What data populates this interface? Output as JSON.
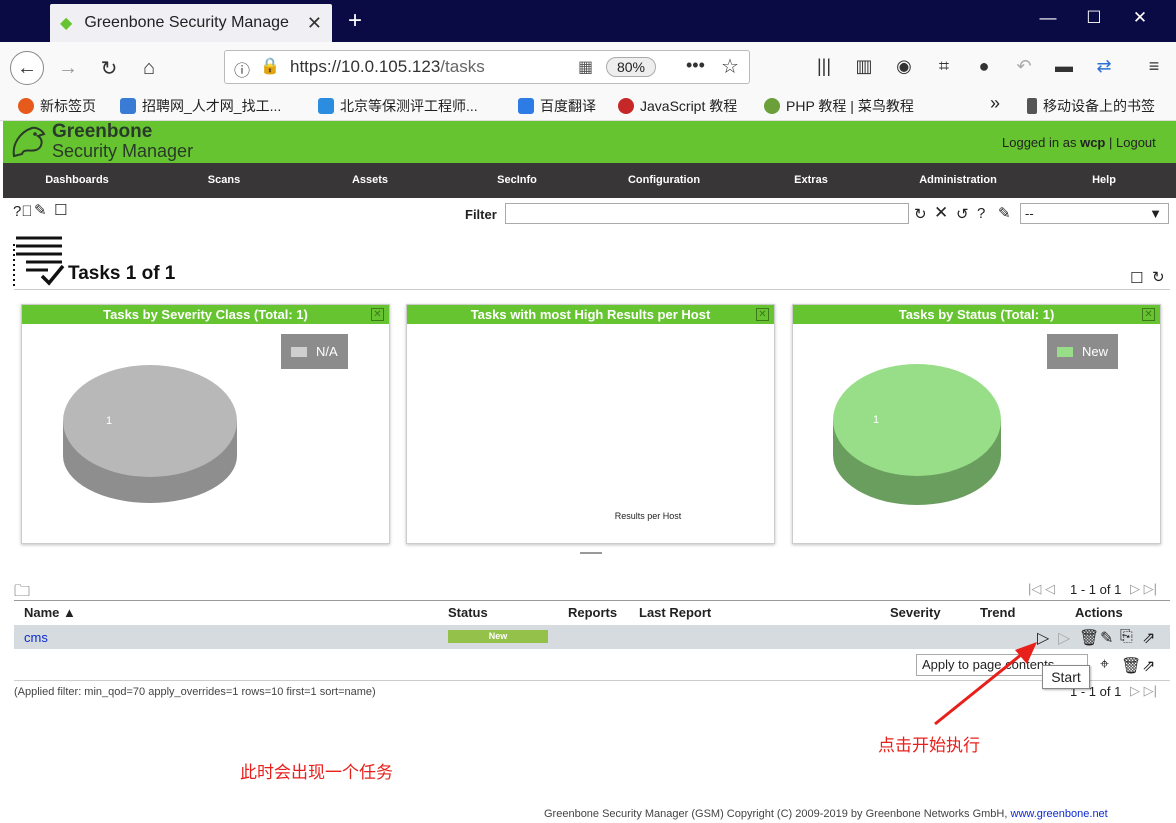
{
  "browser": {
    "tab_title": "Greenbone Security Manager",
    "tab_close": "✕",
    "new_tab": "+",
    "url_host": "https://10.0.105.123",
    "url_path": "/tasks",
    "zoom": "80%",
    "bookmarks": [
      {
        "label": "新标签页",
        "color": "#e65a1c"
      },
      {
        "label": "招聘网_人才网_找工...",
        "color": "#3a7bd5"
      },
      {
        "label": "北京等保测评工程师...",
        "color": "#2a8de0"
      },
      {
        "label": "百度翻译",
        "color": "#2d7be5"
      },
      {
        "label": "JavaScript 教程",
        "color": "#c62828"
      },
      {
        "label": "PHP 教程 | 菜鸟教程",
        "color": "#6a9f3a"
      }
    ],
    "bookmarks_more": "»",
    "mobile_bookmarks": "移动设备上的书签"
  },
  "gsm": {
    "logo_line1": "Greenbone",
    "logo_line2": "Security Manager",
    "logged_in_prefix": "Logged in as",
    "username": "wcp",
    "separator": "|",
    "logout": "Logout",
    "menu": [
      "Dashboards",
      "Scans",
      "Assets",
      "SecInfo",
      "Configuration",
      "Extras",
      "Administration",
      "Help"
    ]
  },
  "toolbar": {
    "filter_label": "Filter",
    "filter_value": "",
    "filter_select": "--"
  },
  "page": {
    "title": "Tasks 1 of 1"
  },
  "charts": {
    "severity": {
      "title": "Tasks by Severity Class (Total: 1)",
      "legend": "N/A",
      "slice_label": "1"
    },
    "high_results": {
      "title": "Tasks with most High Results per Host",
      "axis_label": "Results per Host"
    },
    "status": {
      "title": "Tasks by Status (Total: 1)",
      "legend": "New",
      "slice_label": "1"
    }
  },
  "chart_data": [
    {
      "type": "pie",
      "title": "Tasks by Severity Class (Total: 1)",
      "categories": [
        "N/A"
      ],
      "values": [
        1
      ],
      "colors": [
        "#b8b8b8"
      ]
    },
    {
      "type": "bar",
      "title": "Tasks with most High Results per Host",
      "xlabel": "Results per Host",
      "categories": [],
      "values": []
    },
    {
      "type": "pie",
      "title": "Tasks by Status (Total: 1)",
      "categories": [
        "New"
      ],
      "values": [
        1
      ],
      "colors": [
        "#98de88"
      ]
    }
  ],
  "table": {
    "pager_top": "1 - 1 of 1",
    "pager_bottom": "1 - 1 of 1",
    "columns": {
      "name": "Name ▲",
      "status": "Status",
      "reports": "Reports",
      "last_report": "Last Report",
      "severity": "Severity",
      "trend": "Trend",
      "actions": "Actions"
    },
    "rows": [
      {
        "name": "cms",
        "status": "New",
        "reports": "",
        "last_report": "",
        "severity": "",
        "trend": ""
      }
    ],
    "apply_select": "Apply to page contents",
    "applied_filter": "(Applied filter: min_qod=70 apply_overrides=1 rows=10 first=1 sort=name)",
    "tooltip": "Start"
  },
  "annotations": {
    "task_appears": "此时会出现一个任务",
    "click_start": "点击开始执行"
  },
  "footer": {
    "text": "Greenbone Security Manager (GSM) Copyright (C) 2009-2019 by Greenbone Networks GmbH,",
    "link": "www.greenbone.net"
  }
}
